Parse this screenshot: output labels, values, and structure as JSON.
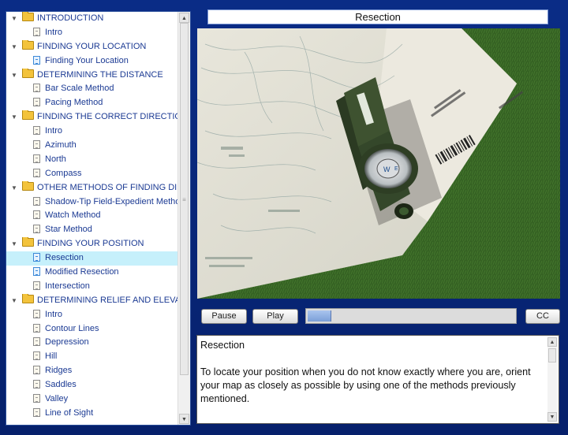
{
  "tree": {
    "items": [
      {
        "type": "chapter",
        "label": "INTRODUCTION"
      },
      {
        "type": "topic",
        "label": "Intro"
      },
      {
        "type": "chapter",
        "label": "FINDING YOUR LOCATION"
      },
      {
        "type": "topic",
        "label": "Finding Your Location",
        "icon": "blue"
      },
      {
        "type": "chapter",
        "label": "DETERMINING THE DISTANCE"
      },
      {
        "type": "topic",
        "label": "Bar Scale Method"
      },
      {
        "type": "topic",
        "label": "Pacing Method"
      },
      {
        "type": "chapter",
        "label": "FINDING THE CORRECT DIRECTIO"
      },
      {
        "type": "topic",
        "label": "Intro"
      },
      {
        "type": "topic",
        "label": "Azimuth"
      },
      {
        "type": "topic",
        "label": "North"
      },
      {
        "type": "topic",
        "label": "Compass"
      },
      {
        "type": "chapter",
        "label": "OTHER METHODS OF FINDING DIR"
      },
      {
        "type": "topic",
        "label": "Shadow-Tip Field-Expedient Metho"
      },
      {
        "type": "topic",
        "label": "Watch Method"
      },
      {
        "type": "topic",
        "label": "Star Method"
      },
      {
        "type": "chapter",
        "label": "FINDING YOUR POSITION"
      },
      {
        "type": "topic",
        "label": "Resection",
        "icon": "blue",
        "selected": true
      },
      {
        "type": "topic",
        "label": "Modified Resection",
        "icon": "blue"
      },
      {
        "type": "topic",
        "label": "Intersection"
      },
      {
        "type": "chapter",
        "label": "DETERMINING RELIEF AND ELEVAT"
      },
      {
        "type": "topic",
        "label": "Intro"
      },
      {
        "type": "topic",
        "label": "Contour Lines"
      },
      {
        "type": "topic",
        "label": "Depression"
      },
      {
        "type": "topic",
        "label": "Hill"
      },
      {
        "type": "topic",
        "label": "Ridges"
      },
      {
        "type": "topic",
        "label": "Saddles"
      },
      {
        "type": "topic",
        "label": "Valley"
      },
      {
        "type": "topic",
        "label": "Line of Sight"
      }
    ]
  },
  "video": {
    "title": "Resection"
  },
  "controls": {
    "pause_label": "Pause",
    "play_label": "Play",
    "cc_label": "CC",
    "progress": 0.11
  },
  "transcript": {
    "heading": "Resection",
    "body": "To locate your position when you do not know exactly where you are, orient your map as closely as possible by using one of the methods previously mentioned."
  },
  "colors": {
    "background": "#0a2c86",
    "link_text": "#1b3a93",
    "selected_row": "#c6f0fb"
  }
}
